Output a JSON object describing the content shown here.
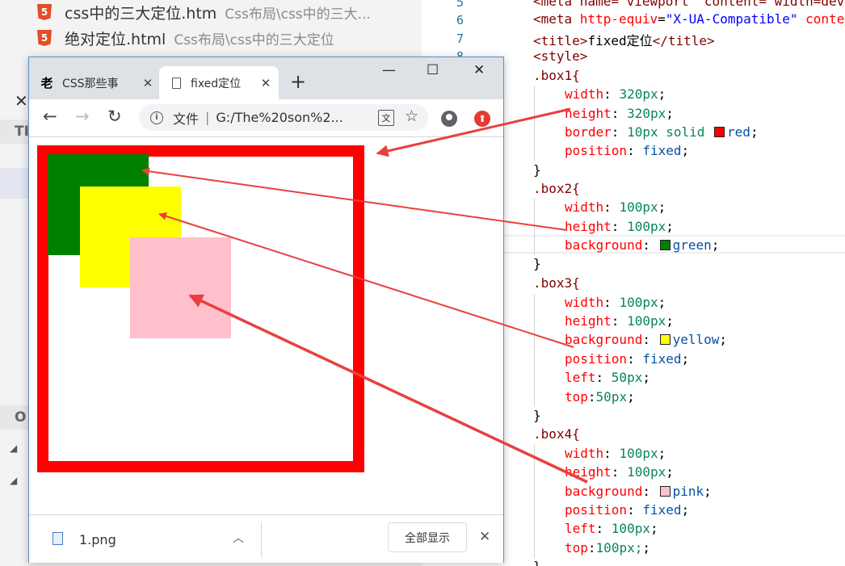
{
  "explorer": {
    "files": [
      {
        "icon": "html5-icon",
        "name": "css中的三大定位.htm",
        "path": "Css布局\\css中的三大..."
      },
      {
        "icon": "html5-icon",
        "name": "绝对定位.html",
        "path": "Css布局\\css中的三大定位"
      }
    ],
    "section_a": "TI",
    "section_b": "O"
  },
  "gutter": {
    "lines": [
      "5",
      "6",
      "7",
      "8"
    ]
  },
  "code": {
    "line_meta": "<meta name=\"viewport\" content=\"width=dev",
    "line_meta2_a": "<meta ",
    "line_meta2_attr": "http-equiv",
    "line_meta2_eq": "=",
    "line_meta2_str": "\"X-UA-Compatible\"",
    "line_meta2_rest": " conte",
    "title_open": "<title>",
    "title_text": "fixed定位",
    "title_close": "</title>",
    "style_open": "<style>",
    "box1_sel": ".box1{",
    "box1_w_p": "width",
    "box1_w_v": "320px",
    "box1_h_p": "height",
    "box1_h_v": "320px",
    "box1_b_p": "border",
    "box1_b_v": "10px solid",
    "box1_b_c": "red",
    "box1_pos_p": "position",
    "box1_pos_v": "fixed",
    "close": "}",
    "box2_sel": ".box2{",
    "box2_w_p": "width",
    "box2_w_v": "100px",
    "box2_h_p": "height",
    "box2_h_v": "100px",
    "box2_bg_p": "background",
    "box2_bg_v": "green",
    "box3_sel": ".box3{",
    "box3_w_p": "width",
    "box3_w_v": "100px",
    "box3_h_p": "height",
    "box3_h_v": "100px",
    "box3_bg_p": "background",
    "box3_bg_v": "yellow",
    "box3_pos_p": "position",
    "box3_pos_v": "fixed",
    "box3_l_p": "left",
    "box3_l_v": "50px",
    "box3_t_p": "top",
    "box3_t_v": "50px",
    "box4_sel": ".box4{",
    "box4_w_p": "width",
    "box4_w_v": "100px",
    "box4_h_p": "height",
    "box4_h_v": "100px",
    "box4_bg_p": "background",
    "box4_bg_v": "pink",
    "box4_pos_p": "position",
    "box4_pos_v": "fixed",
    "box4_l_p": "left",
    "box4_l_v": "100px",
    "box4_t_p": "top",
    "box4_t_v": "100px;"
  },
  "colors": {
    "red": "#ff0000",
    "green": "#008000",
    "yellow": "#ffff00",
    "pink": "#ffc0cb",
    "arrow": "#e8403f"
  },
  "chrome": {
    "tabs": [
      {
        "favicon": "老",
        "label": "CSS那些事",
        "active": false
      },
      {
        "favicon": "page-icon",
        "label": "fixed定位",
        "active": true
      }
    ],
    "newtab": "+",
    "window_controls": {
      "minimize": "—",
      "maximize": "☐",
      "close": "✕"
    },
    "omnibox": {
      "prefix": "文件",
      "sep": "|",
      "url": "G:/The%20son%2..."
    },
    "downloads": {
      "file": "1.png",
      "show_all": "全部显示"
    }
  }
}
